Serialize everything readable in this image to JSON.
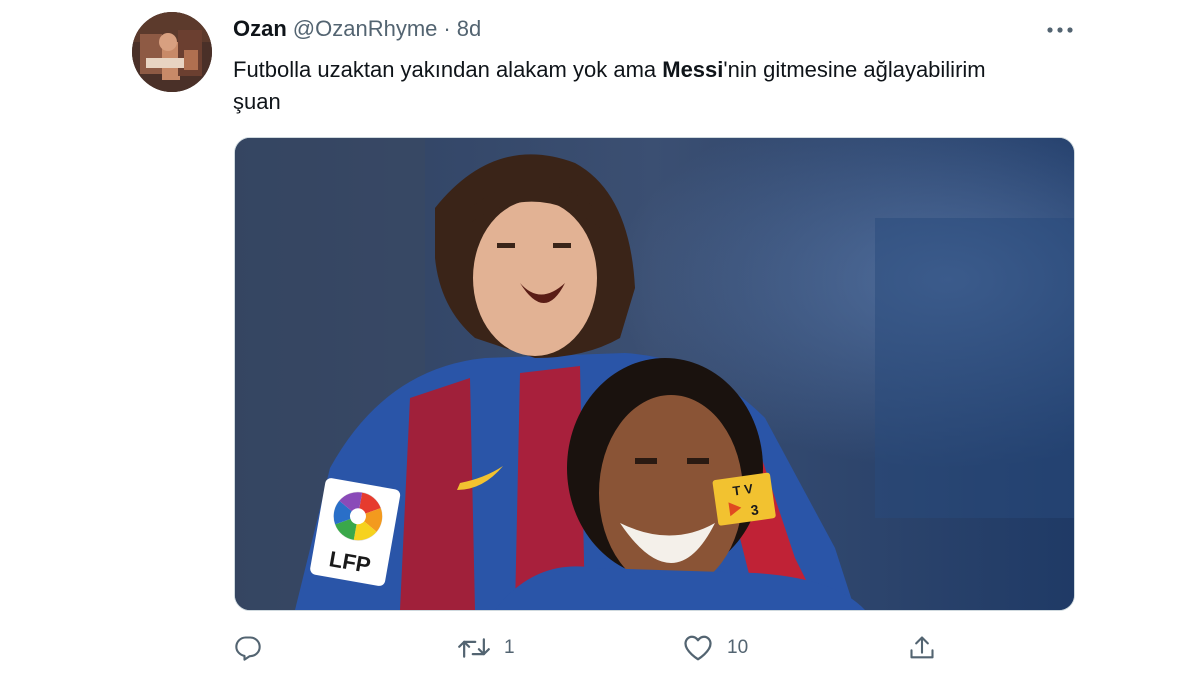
{
  "tweet": {
    "author_name": "Ozan",
    "author_handle": "@OzanRhyme",
    "separator": "·",
    "time": "8d",
    "text_part1": "Futbolla uzaktan yakından alakam yok ama ",
    "text_bold": "Messi",
    "text_part2": "'nin gitmesine ağlayabilirim şuan",
    "image_text": {
      "patch_logo": "LFP",
      "tv3_top": "T V",
      "tv3_bottom": "3"
    }
  },
  "actions": {
    "reply_icon": "reply-icon",
    "retweet_icon": "retweet-icon",
    "retweet_count": "1",
    "like_icon": "heart-icon",
    "like_count": "10",
    "share_icon": "share-icon"
  },
  "colors": {
    "text_primary": "#0f1419",
    "text_secondary": "#536471",
    "border": "#cfd9de"
  }
}
